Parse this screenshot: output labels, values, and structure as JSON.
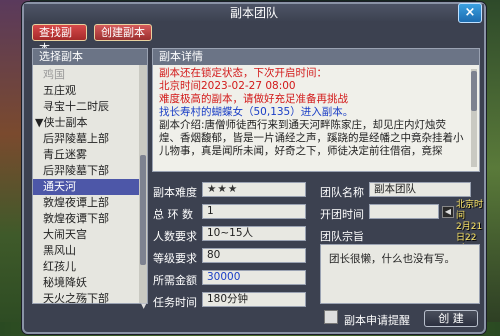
{
  "window": {
    "title": "副本团队",
    "close_label": "×"
  },
  "tabs": [
    {
      "label": "查找副本",
      "active": true
    },
    {
      "label": "创建副本",
      "active": false
    }
  ],
  "left": {
    "header": "选择副本",
    "items": [
      {
        "label": "鸡国",
        "dim": true
      },
      {
        "label": "五庄观"
      },
      {
        "label": "寻宝十二时辰"
      },
      {
        "label": "▼侠士副本",
        "category": true
      },
      {
        "label": "后羿陵墓上部"
      },
      {
        "label": "青丘迷雾"
      },
      {
        "label": "后羿陵墓下部"
      },
      {
        "label": "通天河",
        "selected": true
      },
      {
        "label": "敦煌夜谭上部"
      },
      {
        "label": "敦煌夜谭下部"
      },
      {
        "label": "大闹天宫"
      },
      {
        "label": "黑风山"
      },
      {
        "label": "红孩儿"
      },
      {
        "label": "秘境降妖"
      },
      {
        "label": "天火之殇下部"
      }
    ]
  },
  "detail": {
    "header": "副本详情",
    "line1": "副本还在锁定状态，下次开启时间：",
    "line2": "北京时间2023-02-27 08:00",
    "line3": "难度极高的副本，请做好充足准备再挑战",
    "line4": "找长寿村的蝴蝶女（50,135）进入副本。",
    "intro": "副本介绍:唐僧师徒西行来到通天河畔陈家庄，却见庄内灯烛荧煌、香烟馥郁，皆是一片诵经之声，蹊跷的是经幡之中竟杂挂着小儿物事，真是闻所未闻，好奇之下，师徒决定前往借宿，竟探"
  },
  "form": {
    "difficulty_label": "副本难度",
    "difficulty_value": "★★★",
    "rings_label": "总 环 数",
    "rings_value": "1",
    "people_label": "人数要求",
    "people_value": "10~15人",
    "level_label": "等级要求",
    "level_value": "80",
    "money_label": "所需金额",
    "money_value": "30000",
    "time_label": "任务时间",
    "time_value": "180分钟",
    "team_name_label": "团队名称",
    "team_name_value": "副本团队",
    "open_time_label": "开团时间",
    "open_time_value": "",
    "beijing_line1": "北京时间",
    "beijing_line2": "2月21日22时",
    "motto_label": "团队宗旨",
    "motto_value": "团长很懒，什么也没有写。",
    "apply_label": "副本申请提醒",
    "create_label": "创 建"
  }
}
